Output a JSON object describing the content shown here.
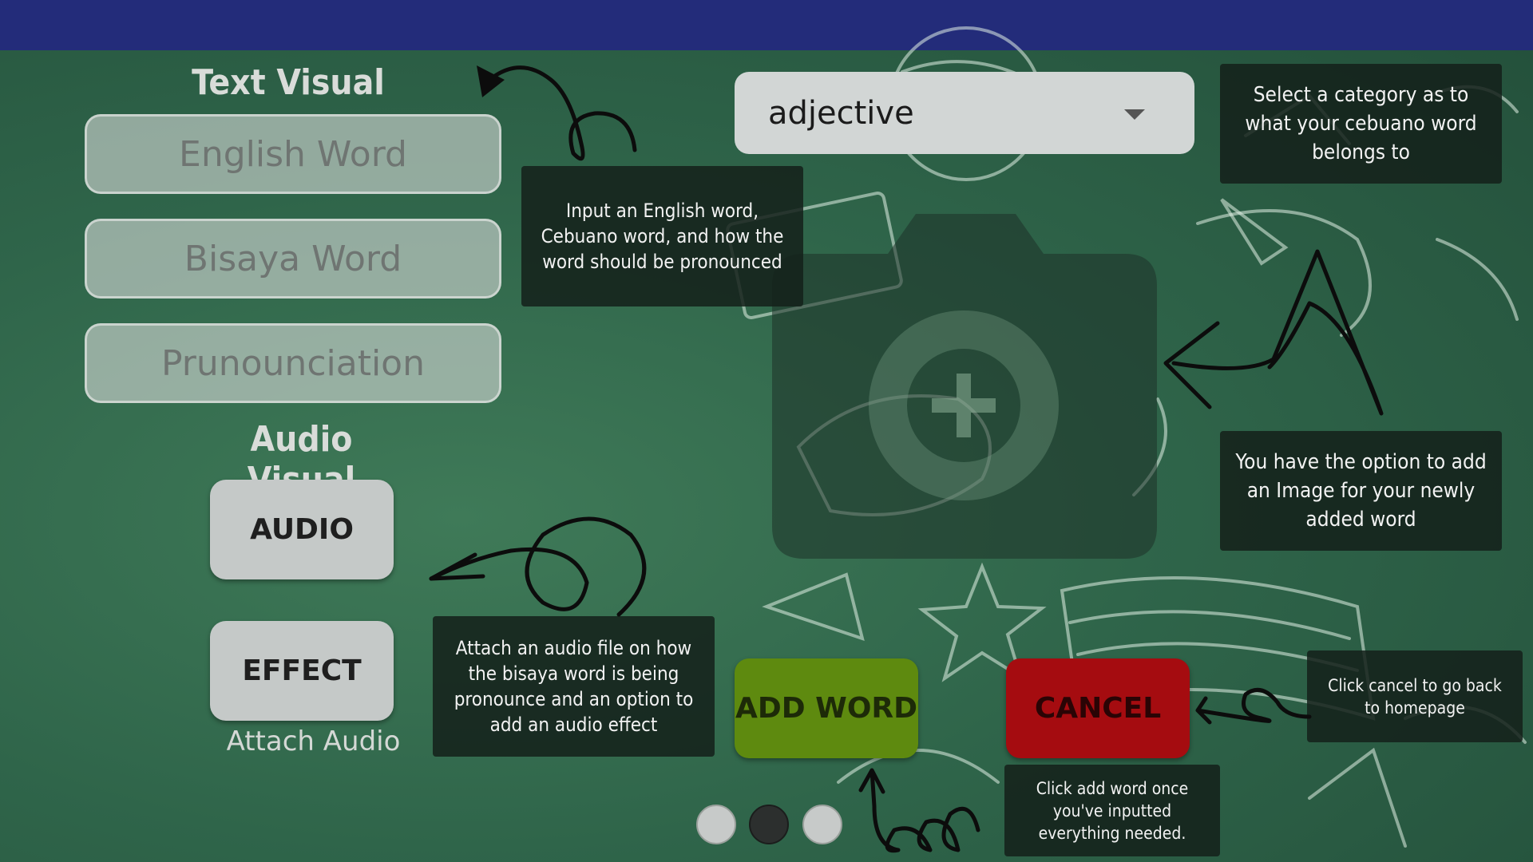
{
  "colors": {
    "topbar": "#232c7a",
    "add_word": "#5e8a0f",
    "cancel": "#a50c10"
  },
  "text_visual": {
    "heading": "Text Visual",
    "english_placeholder": "English Word",
    "bisaya_placeholder": "Bisaya Word",
    "pronunciation_placeholder": "Prunounciation"
  },
  "audio_visual": {
    "heading": "Audio Visual",
    "audio_label": "AUDIO",
    "effect_label": "EFFECT",
    "attach_label": "Attach Audio"
  },
  "category": {
    "selected": "adjective"
  },
  "image_placeholder_icon": "add-photo-icon",
  "actions": {
    "add_word": "ADD WORD",
    "cancel": "CANCEL"
  },
  "tips": {
    "input": "Input an English word, Cebuano word, and how the word should be pronounced",
    "category": "Select a category as to what your cebuano word belongs to",
    "image": "You have the option to add an Image for your newly added word",
    "audio": "Attach an audio file on how the bisaya word is being pronounce and an option to add an audio effect",
    "cancel": "Click cancel to go back to homepage",
    "add": "Click add word once you've inputted everything needed."
  },
  "pager": {
    "count": 3,
    "active": 2
  }
}
